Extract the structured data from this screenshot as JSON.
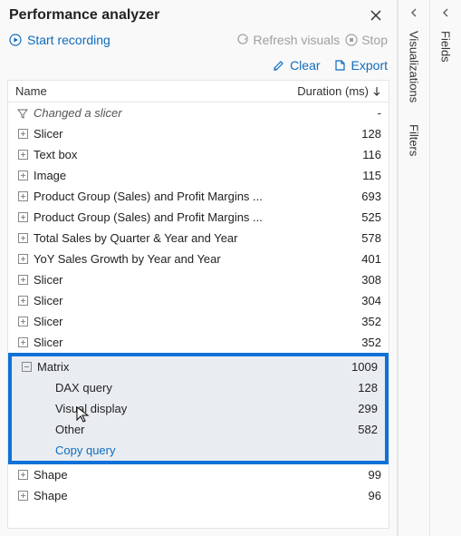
{
  "header": {
    "title": "Performance analyzer"
  },
  "actions": {
    "start_recording": "Start recording",
    "refresh": "Refresh visuals",
    "stop": "Stop",
    "clear": "Clear",
    "export": "Export"
  },
  "table": {
    "columns": {
      "name": "Name",
      "duration": "Duration (ms)"
    },
    "rows": [
      {
        "icon": "filter",
        "name": "Changed a slicer",
        "duration": "-",
        "italic": true
      },
      {
        "icon": "plus",
        "name": "Slicer",
        "duration": "128"
      },
      {
        "icon": "plus",
        "name": "Text box",
        "duration": "116"
      },
      {
        "icon": "plus",
        "name": "Image",
        "duration": "115"
      },
      {
        "icon": "plus",
        "name": "Product Group (Sales) and Profit Margins ...",
        "duration": "693"
      },
      {
        "icon": "plus",
        "name": "Product Group (Sales) and Profit Margins ...",
        "duration": "525"
      },
      {
        "icon": "plus",
        "name": "Total Sales by Quarter & Year and Year",
        "duration": "578"
      },
      {
        "icon": "plus",
        "name": "YoY Sales Growth by Year and Year",
        "duration": "401"
      },
      {
        "icon": "plus",
        "name": "Slicer",
        "duration": "308"
      },
      {
        "icon": "plus",
        "name": "Slicer",
        "duration": "304"
      },
      {
        "icon": "plus",
        "name": "Slicer",
        "duration": "352"
      },
      {
        "icon": "plus",
        "name": "Slicer",
        "duration": "352",
        "clipped": true
      }
    ],
    "highlight": {
      "parent": {
        "icon": "minus",
        "name": "Matrix",
        "duration": "1009"
      },
      "children": [
        {
          "name": "DAX query",
          "duration": "128"
        },
        {
          "name": "Visual display",
          "duration": "299"
        },
        {
          "name": "Other",
          "duration": "582"
        }
      ],
      "copy": "Copy query"
    },
    "after": [
      {
        "icon": "plus",
        "name": "Shape",
        "duration": "99"
      },
      {
        "icon": "plus",
        "name": "Shape",
        "duration": "96"
      }
    ]
  },
  "side": {
    "visualizations": "Visualizations",
    "filters": "Filters",
    "fields": "Fields"
  }
}
